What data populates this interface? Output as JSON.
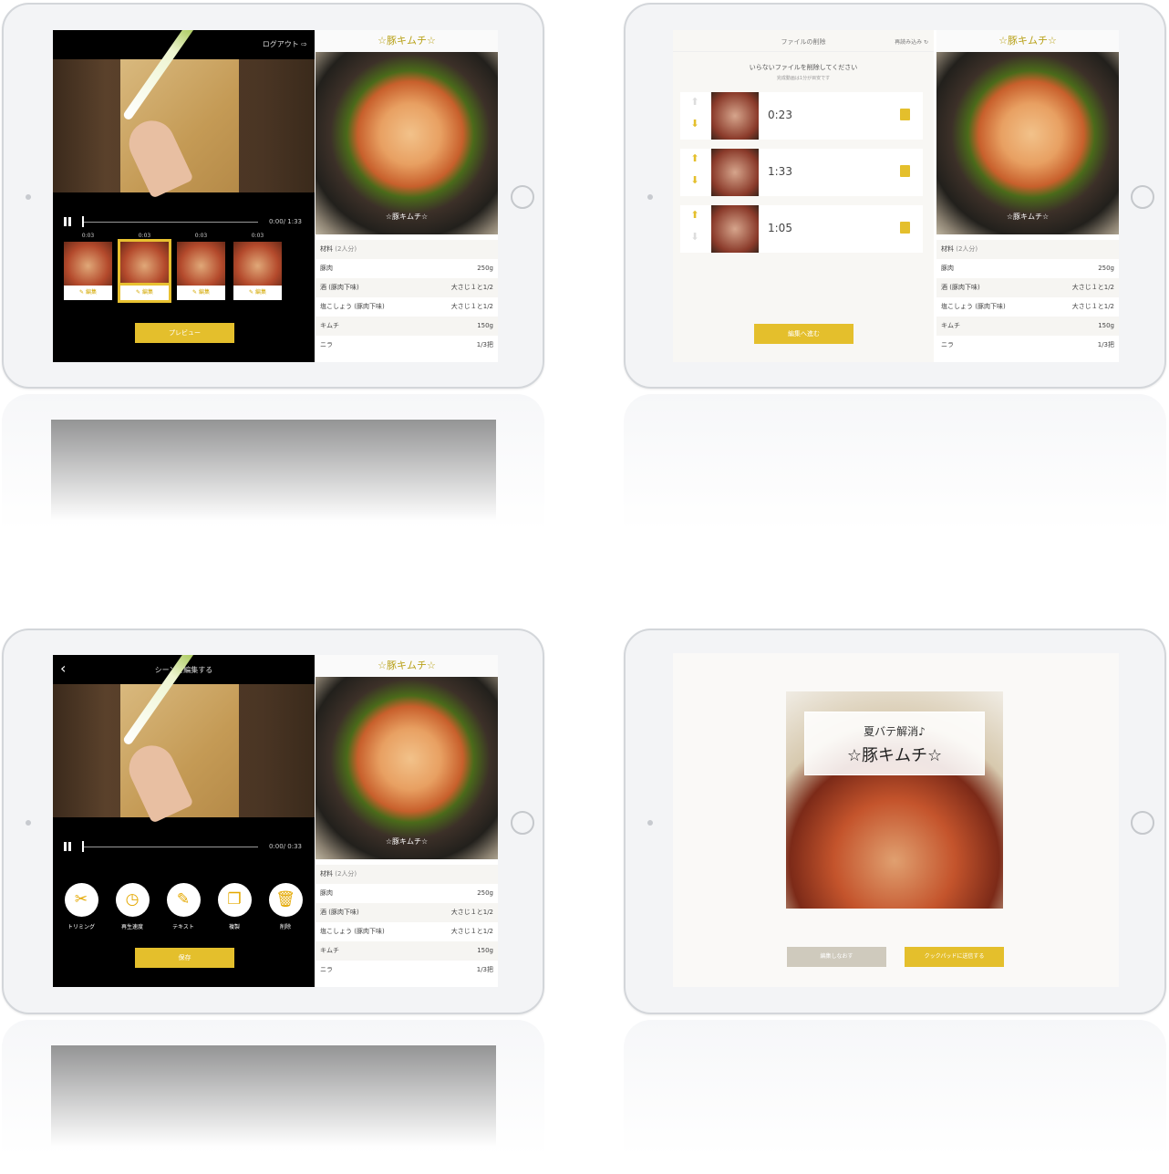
{
  "screen1": {
    "logout": "ログアウト ⇨",
    "time": "0:00/ 1:33",
    "thumbs": [
      {
        "dur": "0:03",
        "edit": "✎ 編集"
      },
      {
        "dur": "0:03",
        "edit": "✎ 編集"
      },
      {
        "dur": "0:03",
        "edit": "✎ 編集"
      },
      {
        "dur": "0:03",
        "edit": "✎ 編集"
      }
    ],
    "preview": "プレビュー"
  },
  "recipe": {
    "title": "☆豚キムチ☆",
    "photo_label": "☆豚キムチ☆",
    "ingredients_label": "材料",
    "servings": "(2人分)",
    "rows": [
      {
        "name": "豚肉",
        "amount": "250g"
      },
      {
        "name": "酒 (豚肉下味)",
        "amount": "大さじ１と1/2"
      },
      {
        "name": "塩こしょう (豚肉下味)",
        "amount": "大さじ１と1/2"
      },
      {
        "name": "キムチ",
        "amount": "150g"
      },
      {
        "name": "ニラ",
        "amount": "1/3把"
      }
    ]
  },
  "screen2": {
    "header": "ファイルの削除",
    "reload": "再読み込み ↻",
    "message": "いらないファイルを削除してください",
    "sub": "完成動画は1分が目安です",
    "items": [
      {
        "time": "0:23"
      },
      {
        "time": "1:33"
      },
      {
        "time": "1:05"
      }
    ],
    "next": "編集へ進む"
  },
  "screen3": {
    "title": "シーンを編集する",
    "time": "0:00/ 0:33",
    "tools": [
      {
        "icon": "scissors-icon",
        "glyph": "✂",
        "label": "トリミング"
      },
      {
        "icon": "timer-icon",
        "glyph": "◷",
        "label": "再生速度"
      },
      {
        "icon": "pencil-icon",
        "glyph": "✎",
        "label": "テキスト"
      },
      {
        "icon": "copy-icon",
        "glyph": "❐",
        "label": "複製"
      },
      {
        "icon": "trash-icon",
        "glyph": "🗑",
        "label": "削除"
      }
    ],
    "save": "保存"
  },
  "screen4": {
    "poster_line1": "夏バテ解消♪",
    "poster_line2": "☆豚キムチ☆",
    "redo": "編集しなおす",
    "send": "クックパッドに送信する"
  },
  "colors": {
    "accent": "#e4bf2c",
    "title_green": "#b9a21a"
  }
}
